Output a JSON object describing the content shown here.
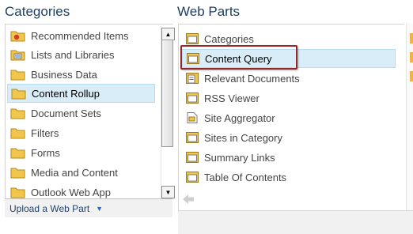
{
  "categories": {
    "title": "Categories",
    "items": [
      {
        "label": "Recommended Items",
        "icon": "folder-star-icon"
      },
      {
        "label": "Lists and Libraries",
        "icon": "folder-list-icon"
      },
      {
        "label": "Business Data",
        "icon": "folder-icon"
      },
      {
        "label": "Content Rollup",
        "icon": "folder-icon",
        "selected": true
      },
      {
        "label": "Document Sets",
        "icon": "folder-icon"
      },
      {
        "label": "Filters",
        "icon": "folder-icon"
      },
      {
        "label": "Forms",
        "icon": "folder-icon"
      },
      {
        "label": "Media and Content",
        "icon": "folder-icon"
      },
      {
        "label": "Outlook Web App",
        "icon": "folder-icon"
      }
    ],
    "upload_label": "Upload a Web Part"
  },
  "web_parts": {
    "title": "Web Parts",
    "items": [
      {
        "label": "Categories",
        "icon": "web-part-icon"
      },
      {
        "label": "Content Query",
        "icon": "web-part-icon",
        "selected": true
      },
      {
        "label": "Relevant Documents",
        "icon": "document-list-icon"
      },
      {
        "label": "RSS Viewer",
        "icon": "web-part-icon"
      },
      {
        "label": "Site Aggregator",
        "icon": "document-icon"
      },
      {
        "label": "Sites in Category",
        "icon": "web-part-icon"
      },
      {
        "label": "Summary Links",
        "icon": "web-part-icon"
      },
      {
        "label": "Table Of Contents",
        "icon": "web-part-icon"
      }
    ]
  },
  "colors": {
    "heading": "#1c3f66",
    "selection_bg": "#d8edf8",
    "highlight_border": "#9c2323",
    "folder": "#f2c54c"
  }
}
